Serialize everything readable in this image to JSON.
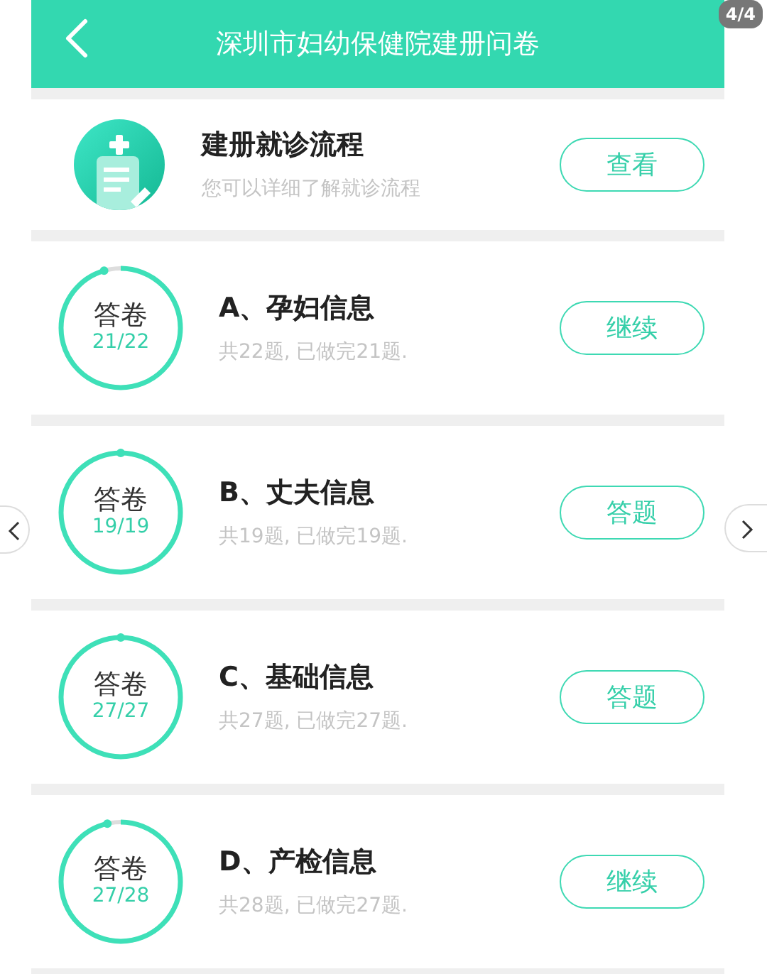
{
  "header": {
    "title": "深圳市妇幼保健院建册问卷"
  },
  "gallery": {
    "counter": "4/4"
  },
  "guide": {
    "title": "建册就诊流程",
    "subtitle": "您可以详细了解就诊流程",
    "button": "查看"
  },
  "questionnaires": [
    {
      "ring_label": "答卷",
      "progress": "21/22",
      "level": 0.955,
      "title": "A、孕妇信息",
      "summary": "共22题, 已做完21题.",
      "button": "继续"
    },
    {
      "ring_label": "答卷",
      "progress": "19/19",
      "level": 1,
      "title": "B、丈夫信息",
      "summary": "共19题, 已做完19题.",
      "button": "答题"
    },
    {
      "ring_label": "答卷",
      "progress": "27/27",
      "level": 1,
      "title": "C、基础信息",
      "summary": "共27题, 已做完27题.",
      "button": "答题"
    },
    {
      "ring_label": "答卷",
      "progress": "27/28",
      "level": 0.964,
      "title": "D、产检信息",
      "summary": "共28题, 已做完27题.",
      "button": "继续"
    }
  ]
}
